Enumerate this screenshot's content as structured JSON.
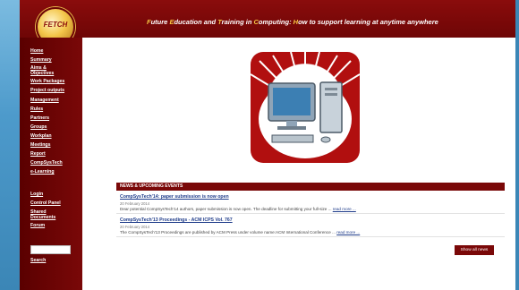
{
  "header": {
    "logo_text": "FETCH",
    "tagline_parts": [
      {
        "text": "F",
        "hl": true
      },
      {
        "text": "uture ",
        "hl": false
      },
      {
        "text": "E",
        "hl": true
      },
      {
        "text": "ducation and ",
        "hl": false
      },
      {
        "text": "T",
        "hl": true
      },
      {
        "text": "raining in ",
        "hl": false
      },
      {
        "text": "C",
        "hl": true
      },
      {
        "text": "omputing: ",
        "hl": false
      },
      {
        "text": "H",
        "hl": true
      },
      {
        "text": "ow to support learning at anytime anywhere",
        "hl": false
      }
    ]
  },
  "sidebar": {
    "items": [
      {
        "label": "Home"
      },
      {
        "label": "Summary"
      },
      {
        "label": "Aims & Objectives"
      },
      {
        "label": "Work Packages"
      },
      {
        "label": "Project outputs"
      },
      {
        "label": "Management"
      },
      {
        "label": "Rules"
      },
      {
        "label": "Partners"
      },
      {
        "label": "Groups"
      },
      {
        "label": "Workplan"
      },
      {
        "label": "Meetings"
      },
      {
        "label": "Report"
      },
      {
        "label": "CompSysTech"
      },
      {
        "label": "e-Learning"
      }
    ],
    "lower_items": [
      {
        "label": "Login"
      },
      {
        "label": "Control Panel"
      },
      {
        "label": "Shared Documents"
      },
      {
        "label": "Forum"
      }
    ],
    "search_label": "Search"
  },
  "news": {
    "header": "NEWS & UPCOMING EVENTS",
    "items": [
      {
        "title": "CompSysTech'14: paper submission is now open",
        "date": "20 February 2014",
        "text": "Dear potential CompSysTech'14 authors, paper submission is now open. The deadline for submitting your full-size ...",
        "more": "read more ..."
      },
      {
        "title": "CompSysTech'13 Proceedings - ACM ICPS Vol. 767",
        "date": "20 February 2014",
        "text": "The CompSysTech'13 Proceedings are published by ACM Press under volume name:ACM International Conference ...",
        "more": "read more ..."
      }
    ],
    "show_all_label": "Show all news"
  },
  "colors": {
    "brand_red": "#7a0808",
    "link_blue": "#1f3c8a",
    "highlight_gold": "#f4c542"
  }
}
